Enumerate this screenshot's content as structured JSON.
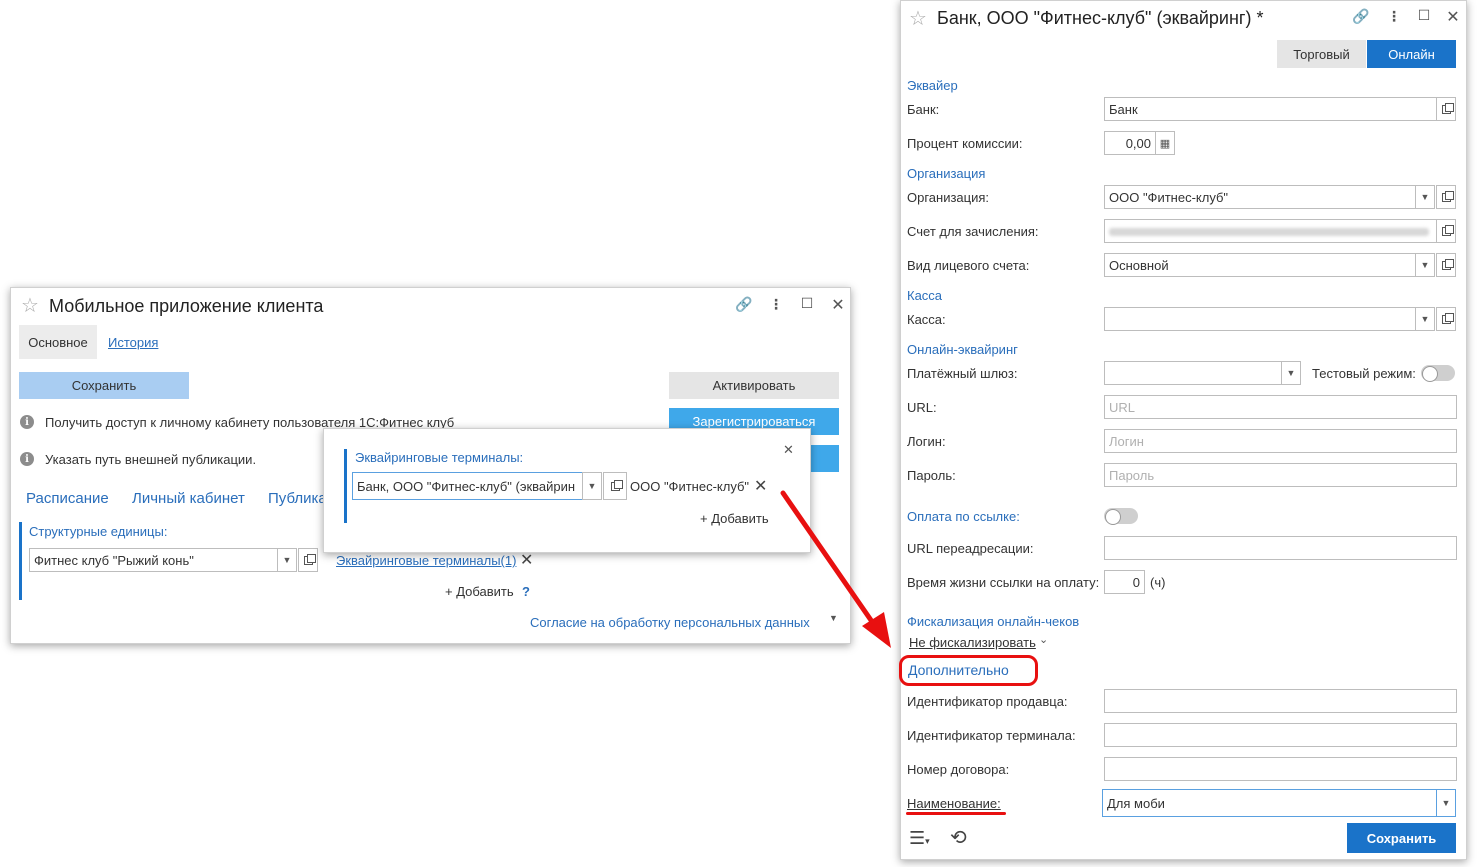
{
  "left_window": {
    "title": "Мобильное приложение клиента",
    "tabs": [
      "Основное",
      "История"
    ],
    "save_label": "Сохранить",
    "activate_label": "Активировать",
    "register_label": "Зарегистрироваться",
    "info1": "Получить доступ к личному кабинету пользователя 1С:Фитнес клуб",
    "info2": "Указать путь внешней публикации.",
    "nav_links": [
      "Расписание",
      "Личный кабинет",
      "Публика"
    ],
    "struct_units_label": "Структурные единицы:",
    "struct_unit_value": "Фитнес клуб \"Рыжий конь\"",
    "terminals_link": "Эквайринговые терминалы(1)",
    "add_label": "+ Добавить",
    "help": "?",
    "consent_link": "Согласие на обработку персональных данных"
  },
  "popup": {
    "label": "Эквайринговые терминалы:",
    "field_value": "Банк, ООО \"Фитнес-клуб\" (эквайрин",
    "org_text": "ООО \"Фитнес-клуб\"",
    "add_label": "+ Добавить"
  },
  "right_window": {
    "title": "Банк, ООО \"Фитнес-клуб\" (эквайринг) *",
    "tabs": [
      "Торговый",
      "Онлайн"
    ],
    "sections": {
      "acquirer": "Эквайер",
      "organization": "Организация",
      "cash": "Касса",
      "online": "Онлайн-эквайринг",
      "pay_link": "Оплата по ссылке:",
      "fiscal": "Фискализация онлайн-чеков",
      "additional": "Дополнительно"
    },
    "labels": {
      "bank": "Банк:",
      "commission": "Процент комиссии:",
      "organization": "Организация:",
      "account": "Счет для зачисления:",
      "account_type": "Вид лицевого счета:",
      "cash": "Касса:",
      "gateway": "Платёжный шлюз:",
      "test_mode": "Тестовый режим:",
      "url": "URL:",
      "login": "Логин:",
      "password": "Пароль:",
      "redirect_url": "URL переадресации:",
      "link_lifetime": "Время жизни ссылки на оплату:",
      "hours": "(ч)",
      "seller_id": "Идентификатор продавца:",
      "terminal_id": "Идентификатор терминала:",
      "contract_no": "Номер договора:",
      "name": "Наименование:"
    },
    "values": {
      "bank": "Банк",
      "commission": "0,00",
      "organization": "ООО \"Фитнес-клуб\"",
      "account_type": "Основной",
      "link_lifetime": "0",
      "fiscal_mode": "Не фискализировать",
      "name": "Для моби"
    },
    "placeholders": {
      "url": "URL",
      "login": "Логин",
      "password": "Пароль"
    },
    "save_label": "Сохранить"
  },
  "colors": {
    "accent": "#1a73c9",
    "link": "#2a6ebb",
    "annotation_red": "#e81010"
  }
}
